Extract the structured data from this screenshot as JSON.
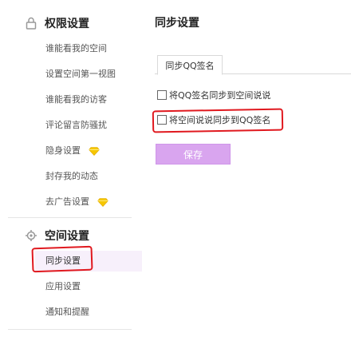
{
  "sidebar": {
    "permissions": {
      "title": "权限设置",
      "items": [
        {
          "label": "谁能看我的空间"
        },
        {
          "label": "设置空间第一视图"
        },
        {
          "label": "谁能看我的访客"
        },
        {
          "label": "评论留言防骚扰"
        },
        {
          "label": "隐身设置",
          "badge_icon": "diamond-icon"
        },
        {
          "label": "封存我的动态"
        },
        {
          "label": "去广告设置",
          "badge_icon": "diamond-icon"
        }
      ]
    },
    "space": {
      "title": "空间设置",
      "items": [
        {
          "label": "同步设置",
          "selected": true
        },
        {
          "label": "应用设置"
        },
        {
          "label": "通知和提醒"
        }
      ]
    }
  },
  "main": {
    "title": "同步设置",
    "tab": "同步QQ签名",
    "options": [
      {
        "label": "将QQ签名同步到空间说说",
        "checked": false
      },
      {
        "label": "将空间说说同步到QQ签名",
        "checked": false
      }
    ],
    "save_label": "保存"
  },
  "colors": {
    "accent": "#d9a5ef",
    "highlight_mark": "#e0191f",
    "active_bg": "#f7f0fb",
    "diamond": "#f6c700"
  }
}
